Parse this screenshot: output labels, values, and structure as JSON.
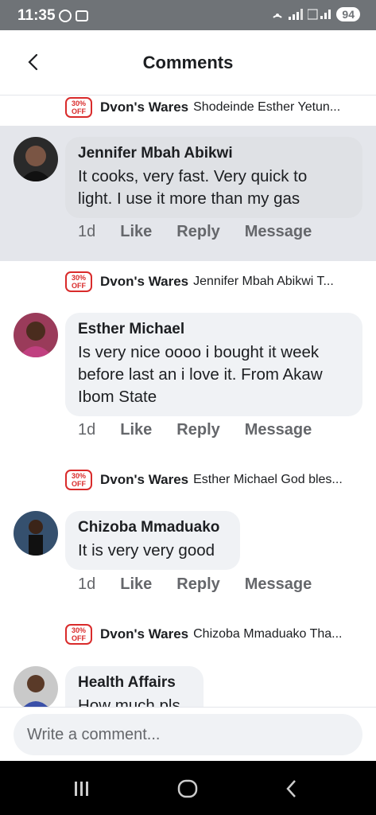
{
  "status": {
    "time": "11:35",
    "battery": "94"
  },
  "header": {
    "title": "Comments"
  },
  "comments": [
    {
      "reply": {
        "author": "Dvon's Wares",
        "text": "Shodeinde Esther Yetun..."
      }
    },
    {
      "author": "Jennifer Mbah Abikwi",
      "lines": [
        "It cooks, very fast. Very quick to",
        "light. I use it more than my gas"
      ],
      "time": "1d",
      "like": "Like",
      "reply_label": "Reply",
      "message": "Message",
      "reply": {
        "author": "Dvon's Wares",
        "text": "Jennifer Mbah Abikwi T..."
      }
    },
    {
      "author": "Esther Michael",
      "lines": [
        "Is very nice oooo i bought it week",
        "before last an i love it. From Akaw",
        "Ibom State"
      ],
      "time": "1d",
      "like": "Like",
      "reply_label": "Reply",
      "message": "Message",
      "reply": {
        "author": "Dvon's Wares",
        "text": "Esther Michael God bles..."
      }
    },
    {
      "author": "Chizoba Mmaduako",
      "lines": [
        "It is very very good"
      ],
      "time": "1d",
      "like": "Like",
      "reply_label": "Reply",
      "message": "Message",
      "reply": {
        "author": "Dvon's Wares",
        "text": "Chizoba Mmaduako Tha..."
      }
    },
    {
      "author": "Health Affairs",
      "lines": [
        "How much pls"
      ]
    }
  ],
  "badge": {
    "line1": "30%",
    "line2": "OFF"
  },
  "composer": {
    "placeholder": "Write a comment..."
  },
  "icons": {
    "back": "chevron-left-icon",
    "recents": "recents-icon",
    "home": "home-icon",
    "nav_back": "back-icon"
  }
}
